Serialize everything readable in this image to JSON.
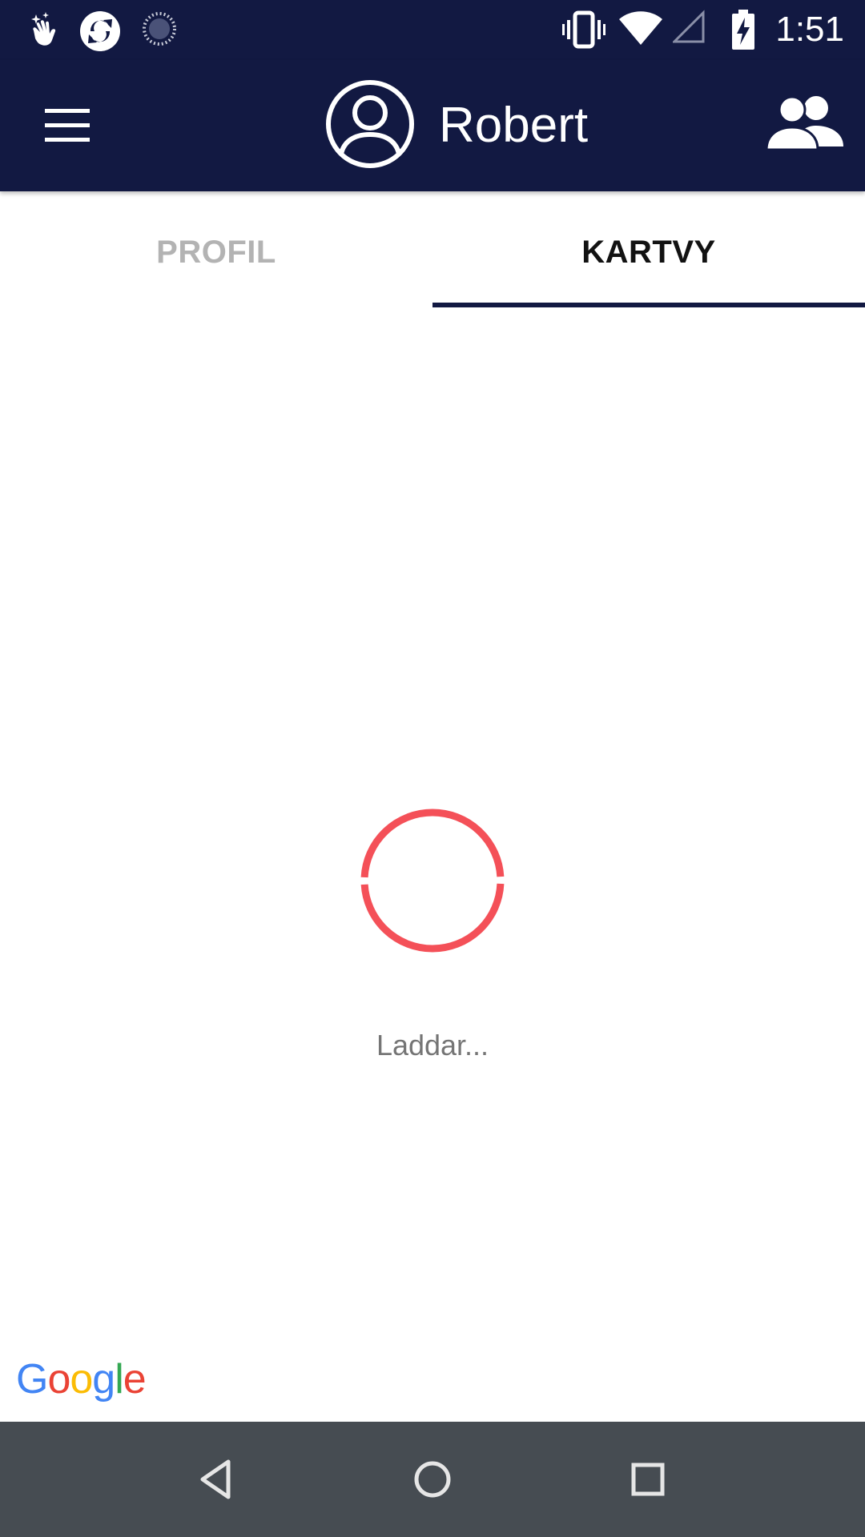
{
  "status_bar": {
    "time": "1:51",
    "icons": [
      "hand-sparkle-icon",
      "sync-app-icon",
      "loading-dots-icon",
      "vibrate-icon",
      "wifi-icon",
      "no-signal-icon",
      "battery-charging-icon"
    ]
  },
  "app_bar": {
    "user_name": "Robert",
    "menu_icon": "hamburger-menu-icon",
    "avatar_icon": "user-circle-icon",
    "friends_icon": "people-icon",
    "background_color": "#121942"
  },
  "tabs": [
    {
      "label": "PROFIL",
      "selected": false
    },
    {
      "label": "KARTVY",
      "selected": true
    }
  ],
  "loading": {
    "text": "Laddar...",
    "spinner_color": "#F45058"
  },
  "map_attribution": {
    "logo_text": "Google"
  },
  "nav_bar": {
    "buttons": [
      "back-icon",
      "home-icon",
      "recents-icon"
    ]
  }
}
